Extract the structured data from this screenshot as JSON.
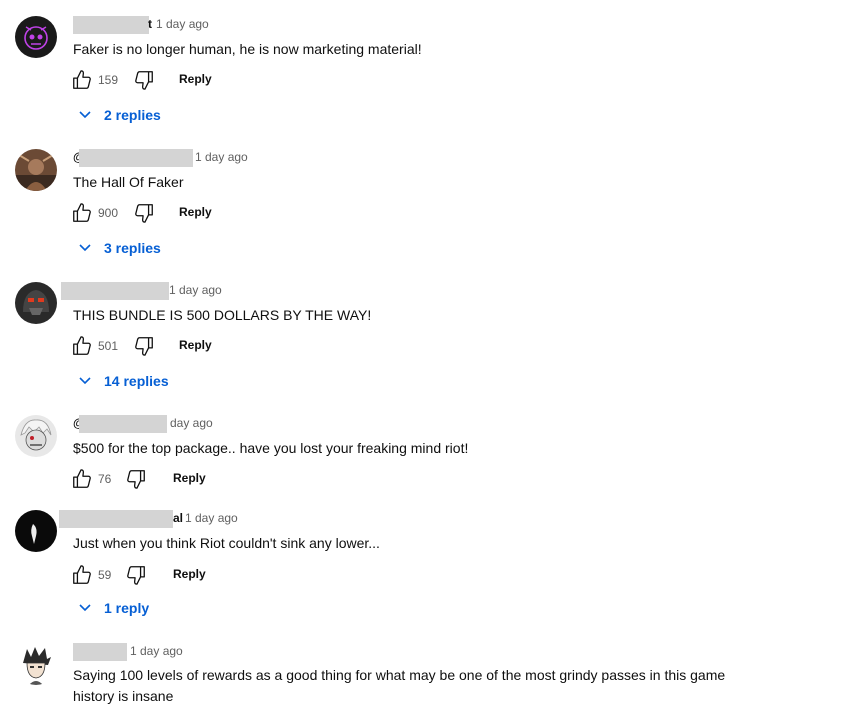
{
  "comments": [
    {
      "author_fragment": "t",
      "timestamp": "1 day ago",
      "text": "Faker is no longer human, he is now marketing material!",
      "likes": "159",
      "reply_label": "Reply",
      "replies_label": "2 replies",
      "avatar": "skull-avatar"
    },
    {
      "author_fragment": "@",
      "timestamp": "1 day ago",
      "text": "The Hall Of Faker",
      "likes": "900",
      "reply_label": "Reply",
      "replies_label": "3 replies",
      "avatar": "warrior-avatar"
    },
    {
      "author_fragment": "",
      "timestamp": "1 day ago",
      "text": "THIS BUNDLE IS 500 DOLLARS BY THE WAY!",
      "likes": "501",
      "reply_label": "Reply",
      "replies_label": "14 replies",
      "avatar": "helmet-avatar"
    },
    {
      "author_fragment": "@",
      "timestamp": "day ago",
      "text": "$500 for the top package.. have you lost your freaking mind riot!",
      "likes": "76",
      "reply_label": "Reply",
      "replies_label": "",
      "avatar": "masked-anime-avatar"
    },
    {
      "author_fragment": "al",
      "timestamp": "1 day ago",
      "text": "Just when you think Riot couldn't sink any lower...",
      "likes": "59",
      "reply_label": "Reply",
      "replies_label": "1 reply",
      "avatar": "dark-avatar"
    },
    {
      "author_fragment": "",
      "timestamp": "1 day ago",
      "text_line1": "Saying 100 levels of rewards as a good thing for what may be one of the most grindy passes in this game",
      "text_line2": "history is insane",
      "avatar": "anime-boy-avatar"
    }
  ],
  "colors": {
    "link": "#065fd4",
    "muted": "#606060",
    "text": "#0f0f0f",
    "redaction": "#d4d4d4"
  }
}
